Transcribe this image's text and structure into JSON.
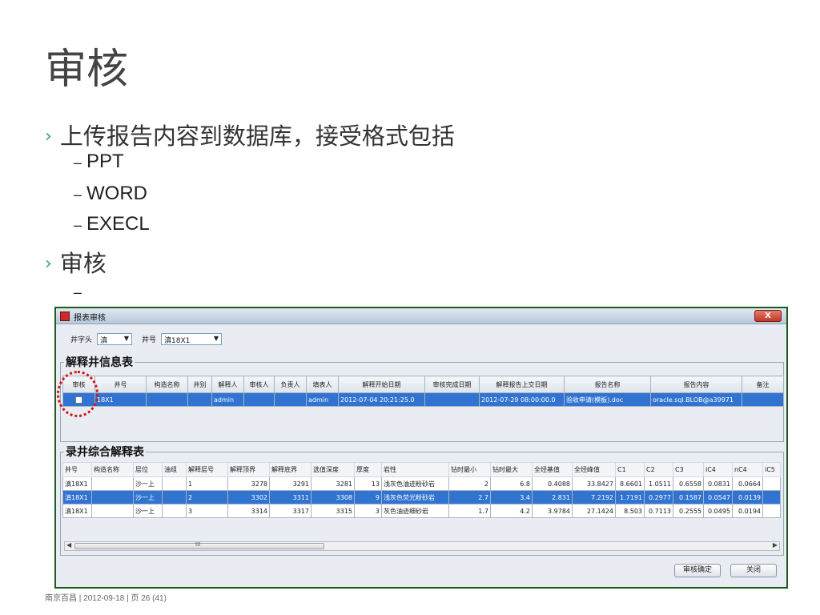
{
  "slide": {
    "title": "审核",
    "bullet1": "上传报告内容到数据库，接受格式包括",
    "sub_items": [
      "PPT",
      "WORD",
      "EXECL"
    ],
    "bullet2": "审核",
    "empty_sub": "",
    "bullet_glyph": "›",
    "dash_glyph": "–"
  },
  "dialog": {
    "title": "报表审核",
    "close_label": "X",
    "filter": {
      "well_head_label": "井字头",
      "well_head_value": "滇",
      "well_label": "井号",
      "well_value": "滇18X1"
    },
    "well_info": {
      "label": "解释井信息表",
      "headers": [
        "审核",
        "井号",
        "构造名称",
        "井别",
        "解释人",
        "审核人",
        "负责人",
        "填表人",
        "解释开始日期",
        "审核完成日期",
        "解释报告上交日期",
        "报告名称",
        "报告内容",
        "备注"
      ],
      "row": [
        "",
        "18X1",
        "",
        "",
        "admin",
        "",
        "",
        "admin",
        "2012-07-04 20:21:25.0",
        "",
        "2012-07-29 08:00:00.0",
        "验收申请(模板).doc",
        "oracle.sql.BLOB@a39971",
        ""
      ]
    },
    "logging": {
      "label": "录井综合解释表",
      "headers": [
        "井号",
        "构造名称",
        "层位",
        "油组",
        "解释层号",
        "解释顶界",
        "解释底界",
        "选值深度",
        "厚度",
        "岩性",
        "钻时最小",
        "钻时最大",
        "全烃基值",
        "全烃峰值",
        "C1",
        "C2",
        "C3",
        "iC4",
        "nC4",
        "iC5"
      ],
      "rows": [
        [
          "滇18X1",
          "",
          "沙一上",
          "",
          "1",
          "3278",
          "3291",
          "3281",
          "13",
          "浅灰色油迹粉砂岩",
          "2",
          "6.8",
          "0.4088",
          "33.8427",
          "8.6601",
          "1.0511",
          "0.6558",
          "0.0831",
          "0.0664",
          ""
        ],
        [
          "滇18X1",
          "",
          "沙一上",
          "",
          "2",
          "3302",
          "3311",
          "3308",
          "9",
          "浅灰色荧光粉砂岩",
          "2.7",
          "3.4",
          "2.831",
          "7.2192",
          "1.7191",
          "0.2977",
          "0.1587",
          "0.0547",
          "0.0139",
          ""
        ],
        [
          "滇18X1",
          "",
          "沙一上",
          "",
          "3",
          "3314",
          "3317",
          "3315",
          "3",
          "灰色油迹细砂岩",
          "1.7",
          "4.2",
          "3.9784",
          "27.1424",
          "8.503",
          "0.7113",
          "0.2555",
          "0.0495",
          "0.0194",
          ""
        ]
      ],
      "selected_row": 1
    },
    "scroll_grip": "III",
    "confirm_button": "审核确定",
    "close_button": "关闭"
  },
  "footer": "南京百昌 | 2012-09-18 | 页 26 (41)",
  "colors": {
    "accent": "#2a9d8f",
    "selection": "#3173d1",
    "frame": "#1e5a1e",
    "highlight": "#d01515"
  }
}
